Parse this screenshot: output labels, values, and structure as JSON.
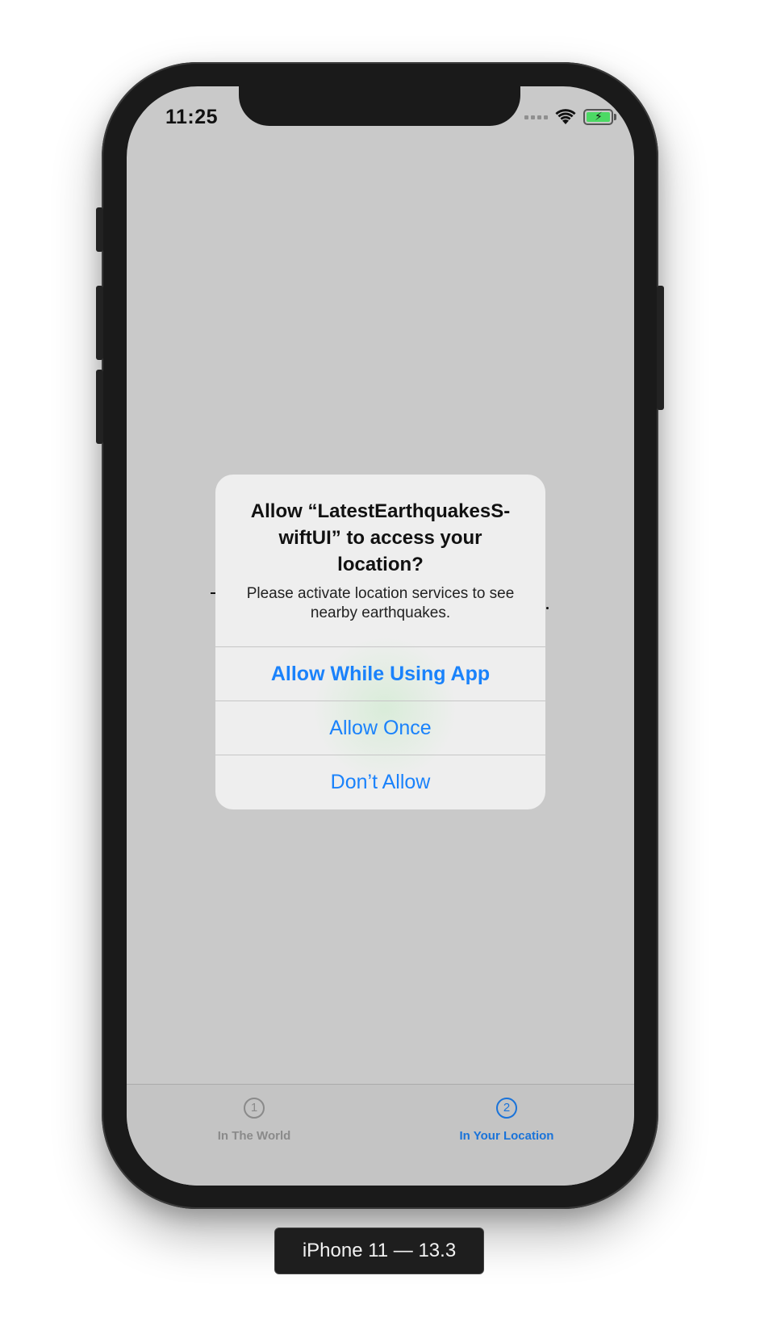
{
  "status_bar": {
    "time": "11:25"
  },
  "alert": {
    "title": "Allow “LatestEarthquakesS-wiftUI” to access your location?",
    "title_line1": "Allow “LatestEarthquakesS-",
    "title_line2": "wiftUI” to access your",
    "title_line3": "location?",
    "message_line1": "Please activate location services to see",
    "message_line2": "nearby earthquakes.",
    "buttons": [
      {
        "label": "Allow While Using App"
      },
      {
        "label": "Allow Once"
      },
      {
        "label": "Don’t Allow"
      }
    ]
  },
  "tab_bar": {
    "tabs": [
      {
        "icon_text": "1",
        "label": "In The World",
        "active": false
      },
      {
        "icon_text": "2",
        "label": "In Your Location",
        "active": true
      }
    ]
  },
  "device_label": "iPhone 11 — 13.3",
  "colors": {
    "accent": "#1a82fb",
    "screen_dim": "#c9c9c9",
    "device_body": "#1a1a1a"
  }
}
